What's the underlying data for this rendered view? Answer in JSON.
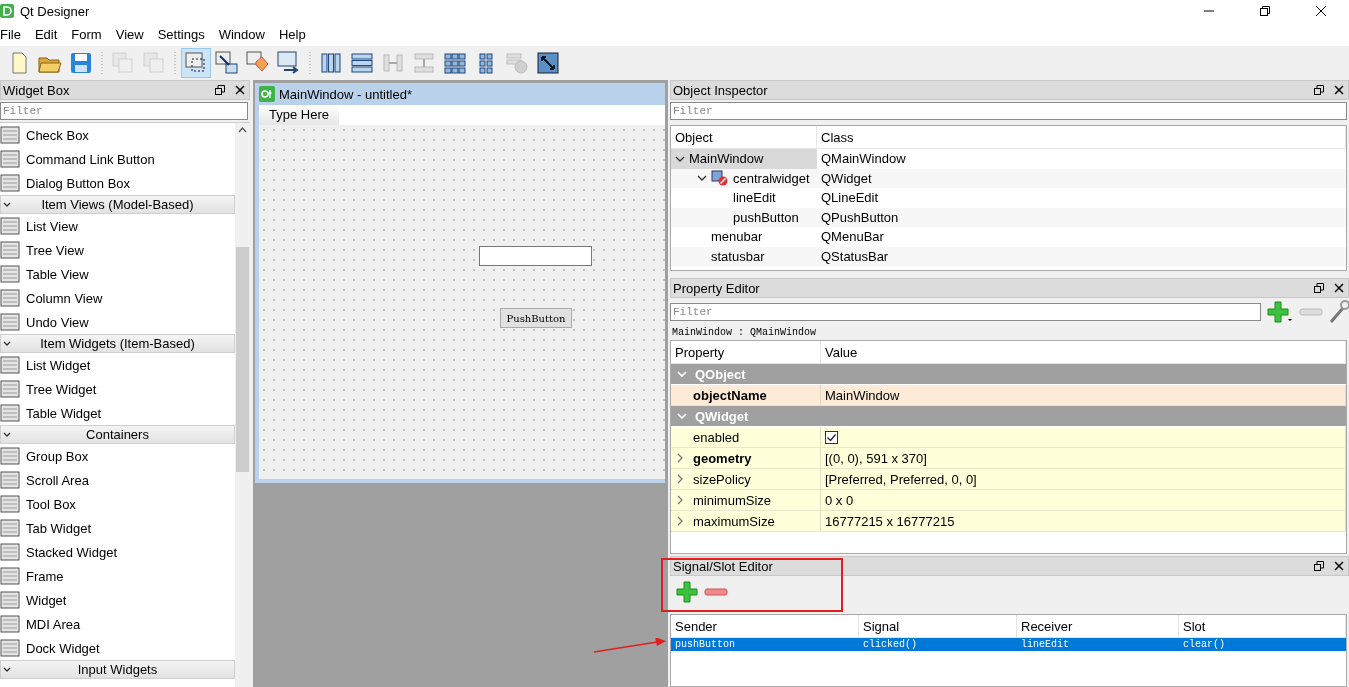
{
  "window": {
    "title": "Qt Designer"
  },
  "menu": [
    "File",
    "Edit",
    "Form",
    "View",
    "Settings",
    "Window",
    "Help"
  ],
  "toolbar": [
    {
      "kind": "new",
      "selected": false,
      "disabled": false
    },
    {
      "kind": "open",
      "selected": false,
      "disabled": false
    },
    {
      "kind": "save",
      "selected": false,
      "disabled": false
    },
    {
      "kind": "separator"
    },
    {
      "kind": "bring_front",
      "selected": false,
      "disabled": true
    },
    {
      "kind": "send_back",
      "selected": false,
      "disabled": true
    },
    {
      "kind": "separator"
    },
    {
      "kind": "edit_widgets",
      "selected": true,
      "disabled": false
    },
    {
      "kind": "edit_signals",
      "selected": false,
      "disabled": false
    },
    {
      "kind": "edit_buddies",
      "selected": false,
      "disabled": false
    },
    {
      "kind": "edit_tab_order",
      "selected": false,
      "disabled": false
    },
    {
      "kind": "separator"
    },
    {
      "kind": "layout_h",
      "selected": false,
      "disabled": false
    },
    {
      "kind": "layout_v",
      "selected": false,
      "disabled": false
    },
    {
      "kind": "split_h",
      "selected": false,
      "disabled": true
    },
    {
      "kind": "split_v",
      "selected": false,
      "disabled": true
    },
    {
      "kind": "layout_grid",
      "selected": false,
      "disabled": false
    },
    {
      "kind": "layout_form",
      "selected": false,
      "disabled": false
    },
    {
      "kind": "break_layout",
      "selected": false,
      "disabled": true
    },
    {
      "kind": "adjust_size",
      "selected": false,
      "disabled": false
    }
  ],
  "widget_box": {
    "title": "Widget Box",
    "filter_placeholder": "Filter",
    "items": [
      {
        "kind": "item",
        "label": "Check Box"
      },
      {
        "kind": "item",
        "label": "Command Link Button"
      },
      {
        "kind": "item",
        "label": "Dialog Button Box"
      },
      {
        "kind": "category",
        "label": "Item Views (Model-Based)",
        "expanded": true
      },
      {
        "kind": "item",
        "label": "List View"
      },
      {
        "kind": "item",
        "label": "Tree View"
      },
      {
        "kind": "item",
        "label": "Table View"
      },
      {
        "kind": "item",
        "label": "Column View"
      },
      {
        "kind": "item",
        "label": "Undo View"
      },
      {
        "kind": "category",
        "label": "Item Widgets (Item-Based)",
        "expanded": true
      },
      {
        "kind": "item",
        "label": "List Widget"
      },
      {
        "kind": "item",
        "label": "Tree Widget"
      },
      {
        "kind": "item",
        "label": "Table Widget"
      },
      {
        "kind": "category",
        "label": "Containers",
        "expanded": true
      },
      {
        "kind": "item",
        "label": "Group Box"
      },
      {
        "kind": "item",
        "label": "Scroll Area"
      },
      {
        "kind": "item",
        "label": "Tool Box"
      },
      {
        "kind": "item",
        "label": "Tab Widget"
      },
      {
        "kind": "item",
        "label": "Stacked Widget"
      },
      {
        "kind": "item",
        "label": "Frame"
      },
      {
        "kind": "item",
        "label": "Widget"
      },
      {
        "kind": "item",
        "label": "MDI Area"
      },
      {
        "kind": "item",
        "label": "Dock Widget"
      },
      {
        "kind": "category",
        "label": "Input Widgets",
        "expanded": true
      }
    ]
  },
  "form": {
    "title": "MainWindow - untitled*",
    "menu_placeholder": "Type Here",
    "widgets": [
      {
        "kind": "line_edit"
      },
      {
        "kind": "push_button",
        "label": "PushButton"
      }
    ]
  },
  "object_inspector": {
    "title": "Object Inspector",
    "filter_placeholder": "Filter",
    "columns": [
      "Object",
      "Class"
    ],
    "tree": [
      {
        "object": "MainWindow",
        "class": "QMainWindow",
        "expanded": true,
        "selected": true,
        "children": [
          {
            "object": "centralwidget",
            "class": "QWidget",
            "expanded": true,
            "selected": false,
            "children": [
              {
                "object": "lineEdit",
                "class": "QLineEdit",
                "selected": false
              },
              {
                "object": "pushButton",
                "class": "QPushButton",
                "selected": false
              }
            ]
          },
          {
            "object": "menubar",
            "class": "QMenuBar",
            "selected": false
          },
          {
            "object": "statusbar",
            "class": "QStatusBar",
            "selected": false
          }
        ]
      }
    ]
  },
  "property_editor": {
    "title": "Property Editor",
    "filter_placeholder": "Filter",
    "subtitle": "MainWindow : QMainWindow",
    "columns": [
      "Property",
      "Value"
    ],
    "groups": [
      {
        "name": "QObject",
        "expanded": true,
        "color": "#fdebd8",
        "properties": [
          {
            "name": "objectName",
            "value": "MainWindow",
            "bold": true,
            "expandable": false
          }
        ]
      },
      {
        "name": "QWidget",
        "expanded": true,
        "color": "#ffffd9",
        "properties": [
          {
            "name": "enabled",
            "kind": "check",
            "checked": true,
            "bold": false,
            "expandable": false
          },
          {
            "name": "geometry",
            "value": "[(0, 0), 591 x 370]",
            "bold": true,
            "expandable": true
          },
          {
            "name": "sizePolicy",
            "value": "[Preferred, Preferred, 0, 0]",
            "bold": false,
            "expandable": true
          },
          {
            "name": "minimumSize",
            "value": "0 x 0",
            "bold": false,
            "expandable": true
          },
          {
            "name": "maximumSize",
            "value": "16777215 x 16777215",
            "bold": false,
            "expandable": true
          }
        ]
      }
    ]
  },
  "signal_slot_editor": {
    "title": "Signal/Slot Editor",
    "columns": [
      "Sender",
      "Signal",
      "Receiver",
      "Slot"
    ],
    "rows": [
      {
        "cells": [
          "pushButton",
          "clicked()",
          "lineEdit",
          "clear()"
        ],
        "selected": true
      }
    ]
  }
}
